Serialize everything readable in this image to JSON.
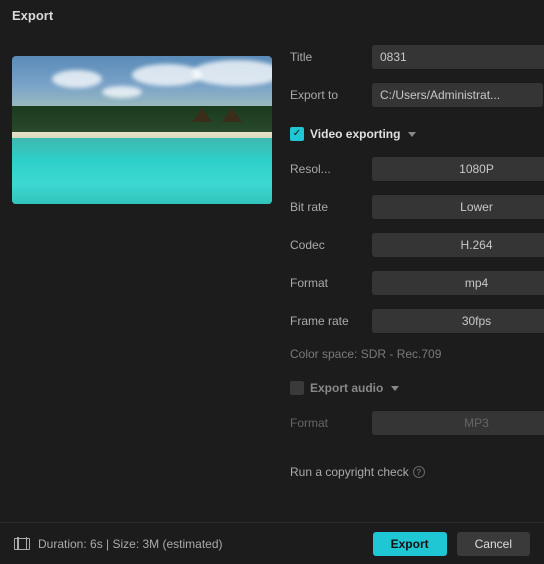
{
  "header": {
    "title": "Export"
  },
  "fields": {
    "title": {
      "label": "Title",
      "value": "0831"
    },
    "exportTo": {
      "label": "Export to",
      "value": "C:/Users/Administrat..."
    }
  },
  "videoSection": {
    "title": "Video exporting",
    "checked": true,
    "resolution": {
      "label": "Resol...",
      "value": "1080P"
    },
    "bitrate": {
      "label": "Bit rate",
      "value": "Lower"
    },
    "codec": {
      "label": "Codec",
      "value": "H.264"
    },
    "format": {
      "label": "Format",
      "value": "mp4"
    },
    "framerate": {
      "label": "Frame rate",
      "value": "30fps"
    },
    "colorSpace": "Color space: SDR - Rec.709"
  },
  "audioSection": {
    "title": "Export audio",
    "checked": false,
    "format": {
      "label": "Format",
      "value": "MP3"
    }
  },
  "copyright": {
    "label": "Run a copyright check",
    "enabled": false
  },
  "footer": {
    "info": "Duration: 6s | Size: 3M (estimated)",
    "exportBtn": "Export",
    "cancelBtn": "Cancel"
  }
}
